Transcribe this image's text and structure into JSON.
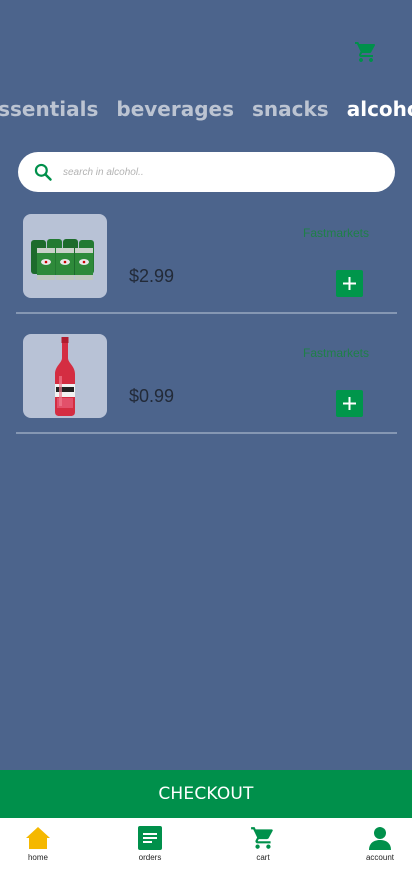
{
  "colors": {
    "background": "#4c648c",
    "accent_green": "#00904b",
    "home_yellow": "#f5b800",
    "tab_inactive": "#bcc4d2",
    "tab_active": "#ffffff"
  },
  "header": {
    "cart_icon": "cart-icon"
  },
  "categories": [
    {
      "label": "essentials",
      "active": false
    },
    {
      "label": "beverages",
      "active": false
    },
    {
      "label": "snacks",
      "active": false
    },
    {
      "label": "alcohol",
      "active": true
    }
  ],
  "search": {
    "placeholder": "search in alcohol..",
    "icon": "search-icon"
  },
  "products": [
    {
      "image": "beer-six-pack",
      "price": "$2.99",
      "origin": "Fastmarkets"
    },
    {
      "image": "breezer-bottle",
      "price": "$0.99",
      "origin": "Fastmarkets"
    }
  ],
  "checkout": {
    "label": "CHECKOUT"
  },
  "bottom_nav": [
    {
      "label": "home",
      "icon": "home-icon"
    },
    {
      "label": "orders",
      "icon": "orders-icon"
    },
    {
      "label": "cart",
      "icon": "cart-icon"
    },
    {
      "label": "account",
      "icon": "account-icon"
    }
  ]
}
